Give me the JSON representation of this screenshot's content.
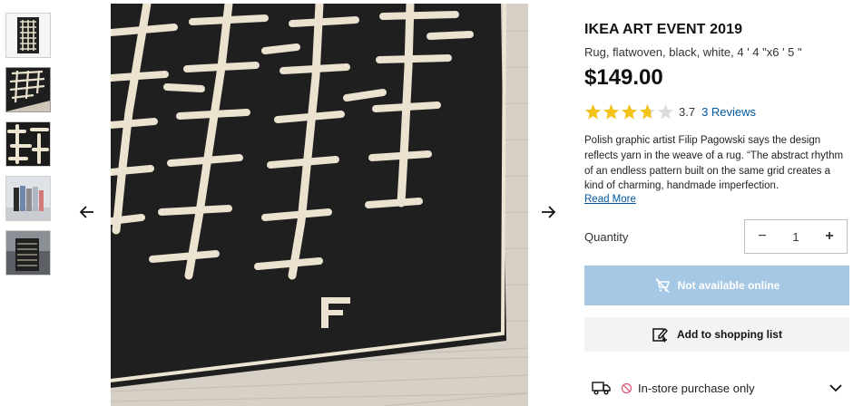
{
  "gallery": {
    "thumbnails": [
      "rug-full-view",
      "rug-closeup-angle",
      "rug-pattern-detail",
      "rugs-rolled-group",
      "rug-in-room"
    ],
    "prev_icon": "arrow-left-icon",
    "next_icon": "arrow-right-icon"
  },
  "product": {
    "brand": "IKEA ART EVENT 2019",
    "subtitle": "Rug, flatwoven, black, white, 4 ' 4 \"x6 ' 5 \"",
    "price": "$149.00",
    "rating_value": "3.7",
    "rating_fraction": 0.74,
    "reviews_link": "3 Reviews",
    "description": "Polish graphic artist Filip Pagowski says the design reflects yarn in the weave of a rug. “The abstract rhythm of an endless pattern built on the same grid creates a kind of charming, handmade imperfection.",
    "read_more": "Read More"
  },
  "quantity": {
    "label": "Quantity",
    "value": "1",
    "minus": "−",
    "plus": "+"
  },
  "actions": {
    "not_available": "Not available online",
    "add_to_list": "Add to shopping list"
  },
  "availability": {
    "instore_text": "In-store purchase only"
  },
  "colors": {
    "star": "#f4c317",
    "star_empty": "#dcdcdc",
    "link": "#0058a3",
    "disabled_button": "#a6c8e4",
    "rug_dark": "#202020",
    "yarn": "#e9e1cc"
  }
}
